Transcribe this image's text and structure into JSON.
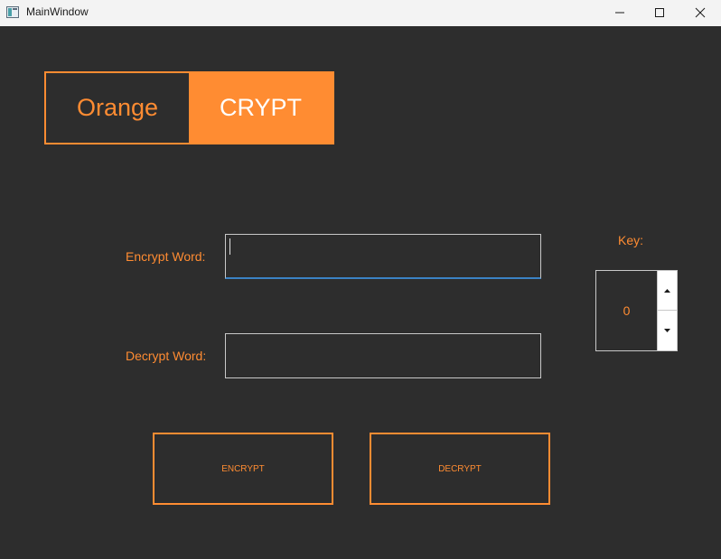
{
  "window": {
    "title": "MainWindow",
    "icon": "app-window-icon",
    "controls": [
      "minimize-icon",
      "maximize-icon",
      "close-icon"
    ]
  },
  "logo": {
    "left_text": "Orange",
    "right_text": "CRYPT"
  },
  "form": {
    "encrypt_label": "Encrypt Word:",
    "encrypt_value": "",
    "decrypt_label": "Decrypt Word:",
    "decrypt_value": "",
    "key_label": "Key:",
    "key_value": "0"
  },
  "actions": {
    "encrypt_label": "ENCRYPT",
    "decrypt_label": "DECRYPT"
  },
  "colors": {
    "accent": "#ff8c32",
    "background": "#2d2d2d",
    "focus": "#3b82c4"
  }
}
